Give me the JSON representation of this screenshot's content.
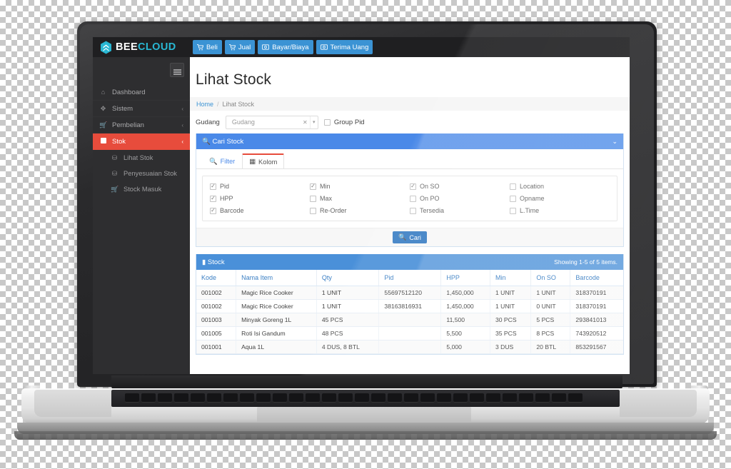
{
  "brand": {
    "word_a": "BEE",
    "word_b": "CLOUD",
    "logo_icon": "hexagon-bee-icon"
  },
  "topnav": [
    {
      "label": "Beli",
      "icon": "cart-icon"
    },
    {
      "label": "Jual",
      "icon": "cart-icon"
    },
    {
      "label": "Bayar/Biaya",
      "icon": "money-icon"
    },
    {
      "label": "Terima Uang",
      "icon": "money-icon"
    }
  ],
  "sidebar": {
    "toggle_icon": "hamburger-icon",
    "items": [
      {
        "label": "Dashboard",
        "icon": "home-icon",
        "caret": "",
        "active": false
      },
      {
        "label": "Sistem",
        "icon": "gears-icon",
        "caret": "‹",
        "active": false
      },
      {
        "label": "Pembelian",
        "icon": "cart-icon",
        "caret": "‹",
        "active": false
      },
      {
        "label": "Stok",
        "icon": "box-icon",
        "caret": "‹",
        "active": true
      }
    ],
    "sub_items": [
      {
        "label": "Lihat Stok",
        "icon": "stack-icon"
      },
      {
        "label": "Penyesuaian Stok",
        "icon": "stack-icon"
      },
      {
        "label": "Stock Masuk",
        "icon": "cart-icon"
      }
    ]
  },
  "page": {
    "title": "Lihat Stock",
    "breadcrumb": {
      "home": "Home",
      "separator": "/",
      "current": "Lihat Stock"
    }
  },
  "filterbar": {
    "gudang_label": "Gudang",
    "gudang_placeholder": "Gudang",
    "gudang_value": "",
    "clear_icon": "close-icon",
    "arrow_icon": "caret-down-icon",
    "group_pid_label": "Group Pid",
    "group_pid_checked": false
  },
  "search_panel": {
    "title": "Cari Stock",
    "title_icon": "search-icon",
    "collapse_icon": "chevron-down-icon",
    "tabs": [
      {
        "label": "Filter",
        "icon": "search-icon",
        "active": false
      },
      {
        "label": "Kolom",
        "icon": "table-icon",
        "active": true
      }
    ],
    "columns": [
      {
        "label": "Pid",
        "checked": true
      },
      {
        "label": "Min",
        "checked": true
      },
      {
        "label": "On SO",
        "checked": true
      },
      {
        "label": "Location",
        "checked": false
      },
      {
        "label": "HPP",
        "checked": true
      },
      {
        "label": "Max",
        "checked": false
      },
      {
        "label": "On PO",
        "checked": false
      },
      {
        "label": "Opname",
        "checked": false
      },
      {
        "label": "Barcode",
        "checked": true
      },
      {
        "label": "Re-Order",
        "checked": false
      },
      {
        "label": "Tersedia",
        "checked": false
      },
      {
        "label": "L.Time",
        "checked": false
      }
    ],
    "submit_label": "Cari",
    "submit_icon": "search-icon"
  },
  "stock_panel": {
    "title": "Stock",
    "title_icon": "briefcase-icon",
    "showing": "Showing 1-5 of 5 items.",
    "columns": [
      "Kode",
      "Nama Item",
      "Qty",
      "Pid",
      "HPP",
      "Min",
      "On  SO",
      "Barcode"
    ],
    "rows": [
      [
        "001002",
        "Magic Rice Cooker",
        "1 UNIT",
        "55697512120",
        "1,450,000",
        "1 UNIT",
        "1 UNIT",
        "318370191"
      ],
      [
        "001002",
        "Magic Rice Cooker",
        "1 UNIT",
        "38163816931",
        "1,450,000",
        "1 UNIT",
        "0 UNIT",
        "318370191"
      ],
      [
        "001003",
        "Minyak Goreng 1L",
        "45 PCS",
        "",
        "11,500",
        "30 PCS",
        "5 PCS",
        "293841013"
      ],
      [
        "001005",
        "Roti Isi Gandum",
        "48 PCS",
        "",
        "5,500",
        "35 PCS",
        "8 PCS",
        "743920512"
      ],
      [
        "001001",
        "Aqua 1L",
        "4 DUS, 8 BTL",
        "",
        "5,000",
        "3 DUS",
        "20 BTL",
        "853291567"
      ]
    ]
  },
  "colors": {
    "brand_cyan": "#29b7d3",
    "nav_blue": "#3b93d4",
    "panel_blue": "#4a89e8",
    "panel_blue_alt": "#4a90d9",
    "sidebar_dark": "#2e2e30",
    "topbar_dark": "#1f1f21",
    "active_red": "#e74c3c",
    "table_header_text": "#3b7fc4"
  }
}
